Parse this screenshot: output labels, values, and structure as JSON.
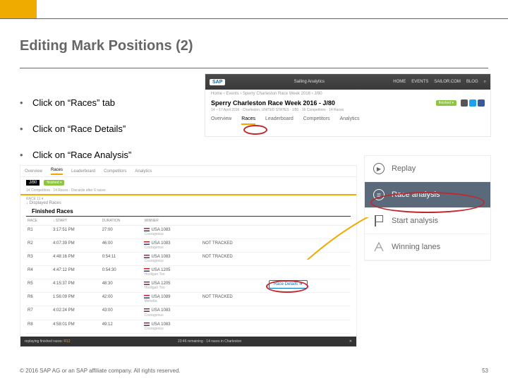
{
  "title": "Editing Mark Positions (2)",
  "bullets": [
    "Click on “Races” tab",
    "Click on “Race Details”",
    "Click on “Race Analysis”"
  ],
  "header_shot": {
    "logo": "SAP",
    "brand": "Sailing Analytics",
    "nav": [
      "HOME",
      "EVENTS",
      "SAILOR.COM",
      "BLOG"
    ],
    "search_icon": "⌕",
    "breadcrumb": "Home › Events › Sperry Charleston Race Week 2016 › J/80",
    "event_title": "Sperry Charleston Race Week 2016 - J/80",
    "status_badge": "finished ▾",
    "subtitle": "14 – 17 April 2016 · Charleston, UNITED STATES · J/80 · 16 Competitors · 14 Races",
    "tabs": [
      "Overview",
      "Races",
      "Leaderboard",
      "Competitors",
      "Analytics"
    ],
    "active_tab": "Races"
  },
  "table_shot": {
    "tabs": [
      "Overview",
      "Races",
      "Leaderboard",
      "Competitors",
      "Analytics"
    ],
    "active_tab": "Races",
    "class_label": "J/80",
    "class_badge": "finished ▾",
    "class_meta": "14 Competitors · 14 Races · Discards after 6 races",
    "race_sel_label": "RACE 11 ▾",
    "heading": "Finished Races",
    "sort_label": "↓ Displayed Races",
    "columns": [
      "RACE",
      "↓ START",
      "DURATION",
      "WINNER",
      "",
      ""
    ],
    "rows": [
      {
        "race": "R1",
        "start": "3:17:51 PM",
        "dur": "27:00",
        "boat": "USA 1083",
        "team": "Courageous",
        "c5": "",
        "c6": ""
      },
      {
        "race": "R2",
        "start": "4:07:39 PM",
        "dur": "46:00",
        "boat": "USA 1083",
        "team": "Courageous",
        "c5": "NOT TRACKED",
        "c6": ""
      },
      {
        "race": "R3",
        "start": "4:48:16 PM",
        "dur": "0:54:11",
        "boat": "USA 1083",
        "team": "Courageous",
        "c5": "NOT TRACKED",
        "c6": ""
      },
      {
        "race": "R4",
        "start": "4:47:12 PM",
        "dur": "0:54:30",
        "boat": "USA 1205",
        "team": "Hooligan Too",
        "c5": "",
        "c6": ""
      },
      {
        "race": "R5",
        "start": "4:15:37 PM",
        "dur": "48:30",
        "boat": "USA 1205",
        "team": "Hooligan Too",
        "c5": "",
        "c6": "Race Details  ➜"
      },
      {
        "race": "R6",
        "start": "1:56:09 PM",
        "dur": "42:00",
        "boat": "USA 1089",
        "team": "Mehetia",
        "c5": "NOT TRACKED",
        "c6": ""
      },
      {
        "race": "R7",
        "start": "4:02:24 PM",
        "dur": "43:00",
        "boat": "USA 1083",
        "team": "Courageous",
        "c5": "",
        "c6": ""
      },
      {
        "race": "R8",
        "start": "4:58:01 PM",
        "dur": "49:12",
        "boat": "USA 1083",
        "team": "Courageous",
        "c5": "",
        "c6": ""
      }
    ],
    "footer_label": "replaying finished races:",
    "footer_value": "R12",
    "footer_count": "23:46 remaining · 14 races in Charleston",
    "footer_close": "✕"
  },
  "menu": [
    {
      "icon": "replay",
      "label": "Replay"
    },
    {
      "icon": "analysis",
      "label": "Race analysis",
      "hl": true
    },
    {
      "icon": "flag",
      "label": "Start analysis"
    },
    {
      "icon": "win",
      "label": "Winning lanes"
    }
  ],
  "footer": {
    "copyright": "© 2016 SAP AG or an SAP affiliate company. All rights reserved.",
    "page": "53"
  }
}
